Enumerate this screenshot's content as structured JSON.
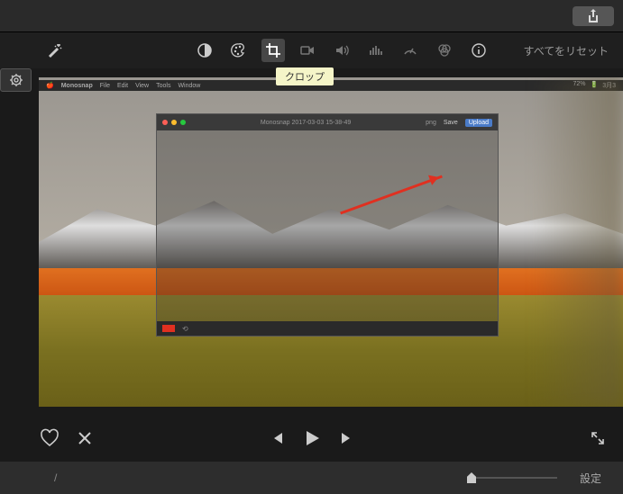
{
  "toolbar": {
    "reset_all": "すべてをリセット",
    "tooltip_crop": "クロップ"
  },
  "menubar": {
    "app": "Monosnap",
    "items": [
      "File",
      "Edit",
      "View",
      "Tools",
      "Window"
    ],
    "battery": "72%",
    "date": "3月3"
  },
  "inner_app": {
    "title": "Monosnap 2017-03-03 15-38-49",
    "format": "png",
    "save": "Save",
    "upload": "Upload"
  },
  "bottom": {
    "separator": "/",
    "settings": "設定"
  }
}
